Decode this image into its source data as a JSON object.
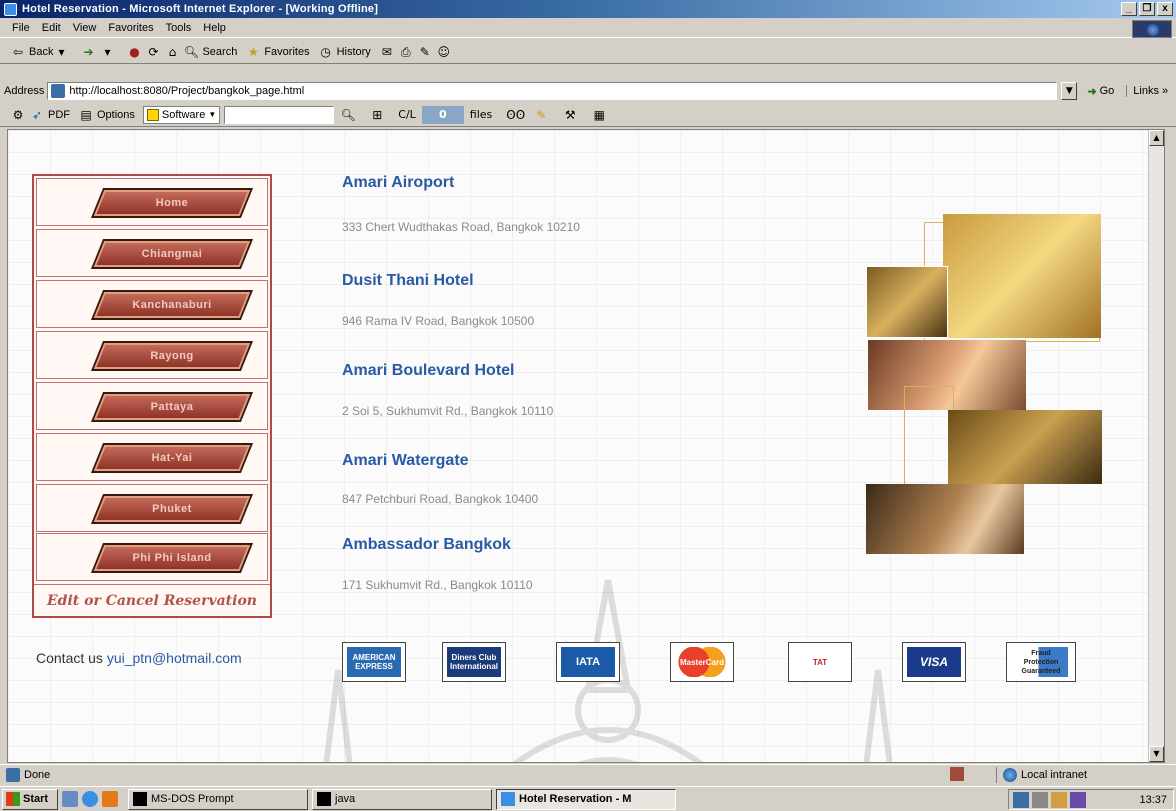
{
  "window": {
    "title": "Hotel Reservation - Microsoft Internet Explorer - [Working Offline]",
    "buttons": [
      "_",
      "❒",
      "x"
    ]
  },
  "menubar": [
    "File",
    "Edit",
    "View",
    "Favorites",
    "Tools",
    "Help"
  ],
  "toolbar": {
    "back": "Back",
    "search": "Search",
    "favorites": "Favorites",
    "history": "History"
  },
  "address": {
    "label": "Address",
    "url": "http://localhost:8080/Project/bangkok_page.html",
    "go": "Go",
    "links": "Links »"
  },
  "toolbar3": {
    "pdf": "PDF",
    "options": "Options",
    "software": "Software",
    "count_label": "C/L",
    "count_value": "0",
    "files": "files"
  },
  "side_menu": {
    "items": [
      "Home",
      "Chiangmai",
      "Kanchanaburi",
      "Rayong",
      "Pattaya",
      "Hat-Yai",
      "Phuket",
      "Phi Phi Island"
    ],
    "edit_link": "Edit or Cancel Reservation"
  },
  "hotels": [
    {
      "name": "Amari Airoport",
      "address": "333 Chert Wudthakas Road, Bangkok 10210"
    },
    {
      "name": "Dusit Thani Hotel",
      "address": "946 Rama IV Road, Bangkok 10500"
    },
    {
      "name": "Amari Boulevard Hotel",
      "address": "2 Soi 5, Sukhumvit Rd., Bangkok 10110"
    },
    {
      "name": "Amari Watergate",
      "address": "847 Petchburi Road, Bangkok 10400"
    },
    {
      "name": "Ambassador Bangkok",
      "address": "171 Sukhumvit Rd., Bangkok 10110"
    }
  ],
  "contact": {
    "label": "Contact us",
    "email": "yui_ptn@hotmail.com"
  },
  "cards": [
    {
      "name": "AMERICAN EXPRESS",
      "color": "#2a6ab0"
    },
    {
      "name": "Diners Club International",
      "color": "#1a3a7a"
    },
    {
      "name": "IATA",
      "color": "#1a5aa6"
    },
    {
      "name": "MasterCard",
      "color": "#e06a1a"
    },
    {
      "name": "TAT",
      "color": "#c02a2a"
    },
    {
      "name": "VISA",
      "color": "#1a3a8a"
    },
    {
      "name": "Fraud Protection Guaranteed",
      "color": "#3a7ac6"
    }
  ],
  "status": {
    "left": "Done",
    "zone": "Local intranet"
  },
  "taskbar": {
    "start": "Start",
    "tasks": [
      "MS-DOS Prompt",
      "java",
      "Hotel Reservation - M"
    ],
    "clock": "13:37"
  }
}
